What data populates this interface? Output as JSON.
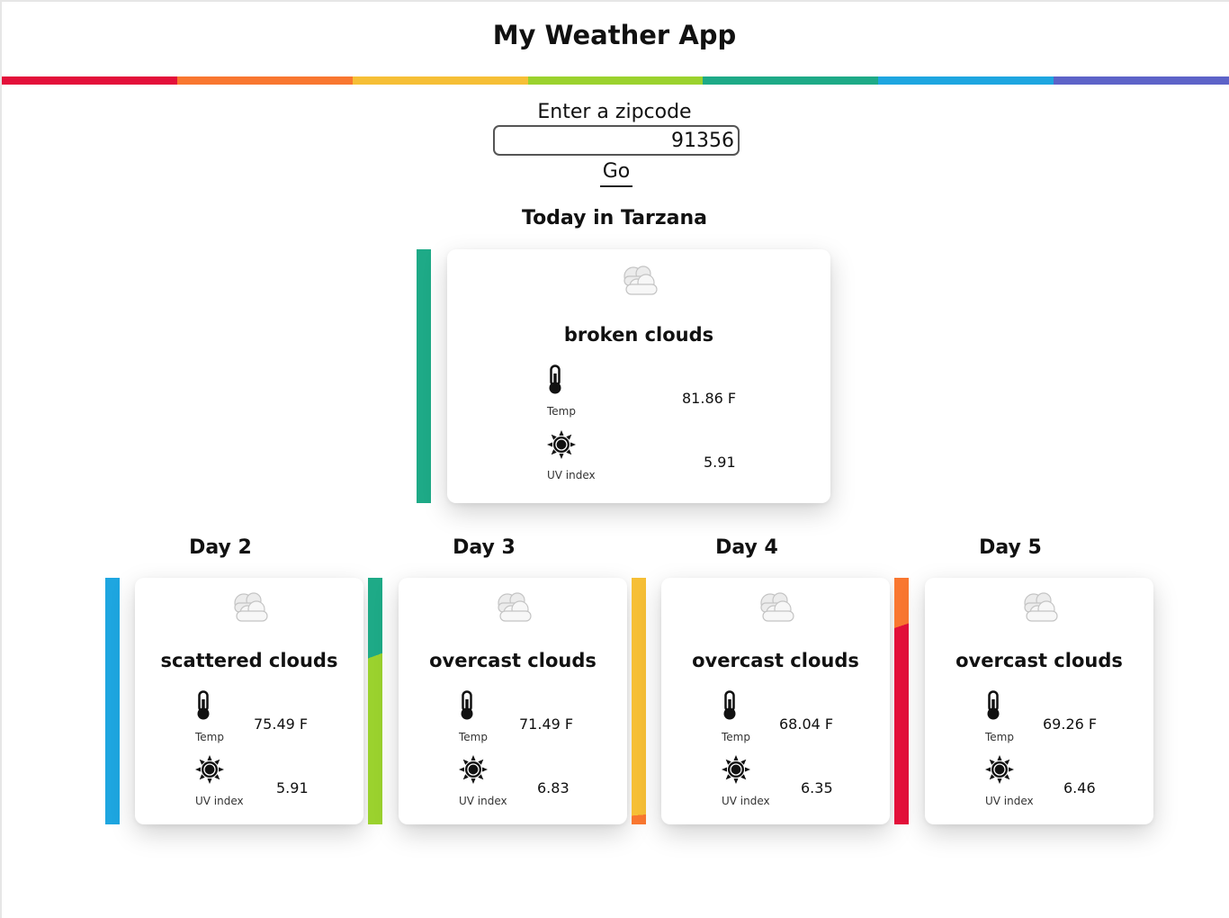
{
  "app": {
    "title": "My Weather App"
  },
  "colors": {
    "rainbow": [
      "#e3103a",
      "#f97730",
      "#f6bf36",
      "#9bd22e",
      "#1eaa87",
      "#1ea6e0",
      "#5d63c8"
    ]
  },
  "search": {
    "label": "Enter a zipcode",
    "value": "91356",
    "button_label": "Go"
  },
  "today": {
    "heading": "Today in Tarzana",
    "icon": "cloud-icon",
    "description": "broken clouds",
    "temp_label": "Temp",
    "temp_value": "81.86 F",
    "uv_label": "UV index",
    "uv_value": "5.91"
  },
  "forecast": [
    {
      "heading": "Day 2",
      "icon": "cloud-icon",
      "description": "scattered clouds",
      "temp_label": "Temp",
      "temp_value": "75.49 F",
      "uv_label": "UV index",
      "uv_value": "5.91"
    },
    {
      "heading": "Day 3",
      "icon": "cloud-icon",
      "description": "overcast clouds",
      "temp_label": "Temp",
      "temp_value": "71.49 F",
      "uv_label": "UV index",
      "uv_value": "6.83"
    },
    {
      "heading": "Day 4",
      "icon": "cloud-icon",
      "description": "overcast clouds",
      "temp_label": "Temp",
      "temp_value": "68.04 F",
      "uv_label": "UV index",
      "uv_value": "6.35"
    },
    {
      "heading": "Day 5",
      "icon": "cloud-icon",
      "description": "overcast clouds",
      "temp_label": "Temp",
      "temp_value": "69.26 F",
      "uv_label": "UV index",
      "uv_value": "6.46"
    }
  ]
}
